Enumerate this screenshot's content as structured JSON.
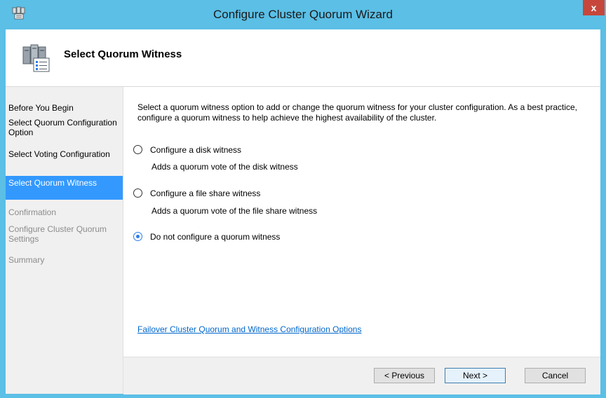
{
  "window": {
    "title": "Configure Cluster Quorum Wizard",
    "close_label": "x"
  },
  "header": {
    "title": "Select Quorum Witness"
  },
  "nav": {
    "items": [
      {
        "label": "Before You Begin",
        "state": "normal"
      },
      {
        "label": "Select Quorum Configuration Option",
        "state": "normal"
      },
      {
        "label": "Select Voting Configuration",
        "state": "normal"
      },
      {
        "label": "Select Quorum Witness",
        "state": "active"
      },
      {
        "label": "Confirmation",
        "state": "disabled"
      },
      {
        "label": "Configure Cluster Quorum Settings",
        "state": "disabled"
      },
      {
        "label": "Summary",
        "state": "disabled"
      }
    ]
  },
  "content": {
    "description": "Select a quorum witness option to add or change the quorum witness for your cluster configuration. As a best practice, configure a quorum witness to help achieve the highest availability of the cluster.",
    "options": [
      {
        "label": "Configure a disk witness",
        "description": "Adds a quorum vote of the disk witness",
        "checked": false
      },
      {
        "label": "Configure a file share witness",
        "description": "Adds a quorum vote of the file share witness",
        "checked": false
      },
      {
        "label": "Do not configure a quorum witness",
        "description": "",
        "checked": true
      }
    ],
    "help_link": "Failover Cluster Quorum and Witness Configuration Options"
  },
  "buttons": {
    "previous": "< Previous",
    "next": "Next >",
    "cancel": "Cancel"
  },
  "colors": {
    "titlebar": "#5bbfe6",
    "selection": "#3399ff",
    "close": "#c7463b",
    "link": "#0066cc"
  }
}
